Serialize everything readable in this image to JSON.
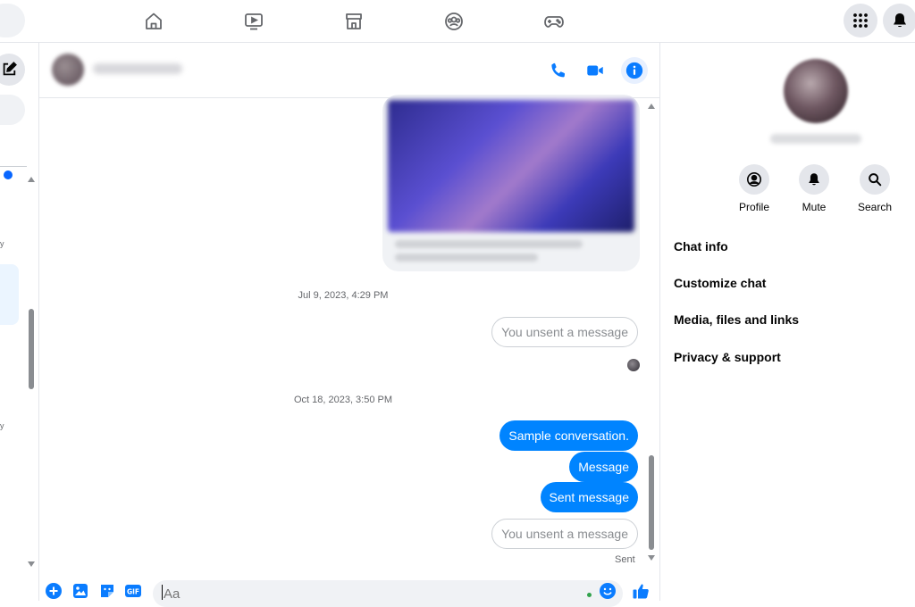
{
  "nav": {
    "icons": [
      "home-icon",
      "watch-icon",
      "marketplace-icon",
      "groups-icon",
      "gaming-icon"
    ],
    "right": [
      "menu-grid-icon",
      "notifications-bell-icon"
    ]
  },
  "chat": {
    "timestamps": [
      "Jul 9, 2023, 4:29 PM",
      "Oct 18, 2023, 3:50 PM"
    ],
    "messages": {
      "unsent_1": "You unsent a message",
      "sent_1": "Sample conversation.",
      "sent_2": "Message",
      "sent_3": "Sent message",
      "unsent_2": "You unsent a message"
    },
    "status": "Sent",
    "composer_placeholder": "Aa"
  },
  "info_panel": {
    "actions": [
      {
        "label": "Profile",
        "icon": "profile-icon"
      },
      {
        "label": "Mute",
        "icon": "bell-icon"
      },
      {
        "label": "Search",
        "icon": "search-icon"
      }
    ],
    "menu": [
      "Chat info",
      "Customize chat",
      "Media, files and links",
      "Privacy & support"
    ]
  },
  "colors": {
    "accent": "#0084ff",
    "brand_blue": "#0866ff",
    "header_icons": "#0a7cff"
  }
}
